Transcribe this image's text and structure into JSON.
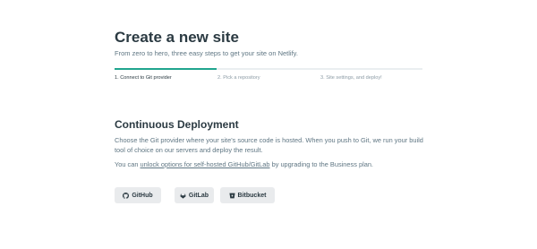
{
  "header": {
    "title": "Create a new site",
    "subtitle": "From zero to hero, three easy steps to get your site on Netlify."
  },
  "steps": {
    "items": [
      {
        "label": "1. Connect to Git provider"
      },
      {
        "label": "2. Pick a repository"
      },
      {
        "label": "3. Site settings, and deploy!"
      }
    ],
    "active_index": 0,
    "progress_fraction": 0.33,
    "accent_color": "#20a58e"
  },
  "section": {
    "title": "Continuous Deployment",
    "description": "Choose the Git provider where your site's source code is hosted. When you push to Git, we run your build tool of choice on our servers and deploy the result.",
    "note_prefix": "You can ",
    "note_link": "unlock options for self-hosted GitHub/GitLab",
    "note_suffix": " by upgrading to the Business plan."
  },
  "providers": [
    {
      "label": "GitHub",
      "icon": "github-icon"
    },
    {
      "label": "GitLab",
      "icon": "gitlab-icon"
    },
    {
      "label": "Bitbucket",
      "icon": "bitbucket-icon"
    }
  ]
}
